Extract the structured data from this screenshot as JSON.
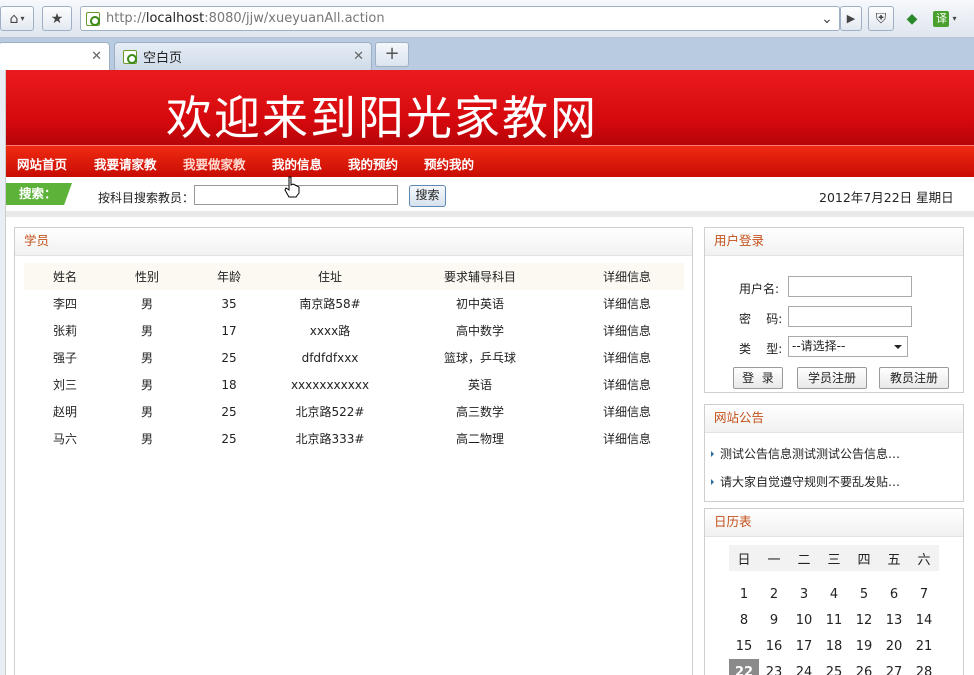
{
  "browser": {
    "url_prefix": "http://",
    "url_host": "localhost",
    "url_rest": ":8080/jjw/xueyuanAll.action",
    "tabs": [
      {
        "label": ""
      },
      {
        "label": "空白页"
      }
    ],
    "new_tab_label": "+",
    "icons": [
      "home-icon",
      "star-icon",
      "reload-icon",
      "forward-icon",
      "shield-icon",
      "cube-icon",
      "translate-icon"
    ]
  },
  "site": {
    "banner_title": "欢迎来到阳光家教网",
    "nav": [
      {
        "label": "网站首页"
      },
      {
        "label": "我要请家教"
      },
      {
        "label": "我要做家教"
      },
      {
        "label": "我的信息"
      },
      {
        "label": "我的预约"
      },
      {
        "label": "预约我的"
      }
    ],
    "search": {
      "tag": "搜索：",
      "label": "按科目搜索教员：",
      "value": "",
      "button": "搜索"
    },
    "date": "2012年7月22日  星期日"
  },
  "students": {
    "title": "学员",
    "columns": [
      "姓名",
      "性别",
      "年龄",
      "住址",
      "要求辅导科目",
      "详细信息"
    ],
    "rows": [
      [
        "李四",
        "男",
        "35",
        "南京路58#",
        "初中英语",
        "详细信息"
      ],
      [
        "张莉",
        "男",
        "17",
        "xxxx路",
        "高中数学",
        "详细信息"
      ],
      [
        "强子",
        "男",
        "25",
        "dfdfdfxxx",
        "篮球，乒乓球",
        "详细信息"
      ],
      [
        "刘三",
        "男",
        "18",
        "xxxxxxxxxxx",
        "英语",
        "详细信息"
      ],
      [
        "赵明",
        "男",
        "25",
        "北京路522#",
        "高三数学",
        "详细信息"
      ],
      [
        "马六",
        "男",
        "25",
        "北京路333#",
        "高二物理",
        "详细信息"
      ]
    ]
  },
  "login": {
    "title": "用户登录",
    "username_label": "用户名:",
    "password_label": "密    码:",
    "type_label": "类    型:",
    "type_selected": "--请选择--",
    "login_button": "登  录",
    "student_register": "学员注册",
    "teacher_register": "教员注册"
  },
  "notices": {
    "title": "网站公告",
    "items": [
      "测试公告信息测试测试公告信息…",
      "请大家自觉遵守规则不要乱发贴…"
    ]
  },
  "calendar": {
    "title": "日历表",
    "weekdays": [
      "日",
      "一",
      "二",
      "三",
      "四",
      "五",
      "六"
    ],
    "weeks": [
      [
        "1",
        "2",
        "3",
        "4",
        "5",
        "6",
        "7"
      ],
      [
        "8",
        "9",
        "10",
        "11",
        "12",
        "13",
        "14"
      ],
      [
        "15",
        "16",
        "17",
        "18",
        "19",
        "20",
        "21"
      ],
      [
        "22",
        "23",
        "24",
        "25",
        "26",
        "27",
        "28"
      ]
    ],
    "today": "22"
  },
  "colors": {
    "banner_red": "#d4080c",
    "nav_red": "#e01a0a",
    "search_green": "#5db33a",
    "panel_title": "#c4511b"
  }
}
